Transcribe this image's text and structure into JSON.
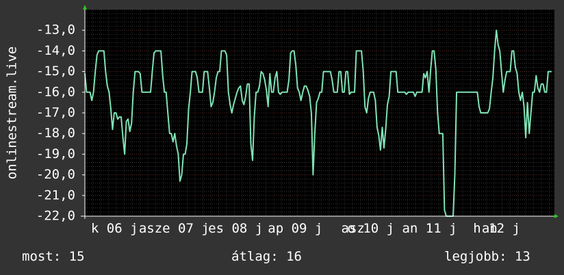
{
  "chart_data": {
    "type": "line",
    "ylabel": "onlinestream.live",
    "ylim": [
      -22.0,
      -12.0
    ],
    "y_ticks": [
      "-13,0",
      "-14,0",
      "-15,0",
      "-16,0",
      "-17,0",
      "-18,0",
      "-19,0",
      "-20,0",
      "-21,0",
      "-22,0"
    ],
    "y_tick_values": [
      -13,
      -14,
      -15,
      -16,
      -17,
      -18,
      -19,
      -20,
      -21,
      -22
    ],
    "x_ticks": [
      "k 06 j",
      "asze 07 j",
      "es 08 j",
      "ap 09 j",
      "asz",
      "o 10 j",
      "an 11 j",
      "an",
      "h 12 j"
    ],
    "x_tick_positions": [
      0.063,
      0.19,
      0.321,
      0.448,
      0.571,
      0.609,
      0.734,
      0.862,
      0.877
    ],
    "x_range": [
      0,
      100
    ],
    "grid": true,
    "series_color": "#7fe3b5",
    "series": [
      {
        "values": [
          -15.1,
          -16.0,
          -16.0,
          -16.0,
          -16.4,
          -16.0,
          -15.0,
          -14.2,
          -14.0,
          -14.0,
          -14.0,
          -14.0,
          -15.0,
          -15.7,
          -16.0,
          -16.8,
          -17.8,
          -17.0,
          -17.0,
          -17.3,
          -17.2,
          -17.2,
          -18.2,
          -19.0,
          -17.4,
          -17.3,
          -17.9,
          -17.5,
          -16.0,
          -15.0,
          -15.0,
          -15.0,
          -15.1,
          -16.0,
          -16.0,
          -16.0,
          -16.0,
          -16.0,
          -16.0,
          -15.0,
          -14.1,
          -14.0,
          -14.0,
          -14.0,
          -14.0,
          -15.2,
          -16.0,
          -16.0,
          -17.0,
          -18.0,
          -18.0,
          -18.4,
          -18.0,
          -18.6,
          -19.0,
          -20.3,
          -20.0,
          -19.0,
          -19.0,
          -18.5,
          -16.8,
          -16.0,
          -15.0,
          -15.0,
          -15.0,
          -15.3,
          -16.0,
          -16.0,
          -16.0,
          -15.0,
          -15.0,
          -15.0,
          -15.8,
          -16.7,
          -16.5,
          -16.0,
          -15.3,
          -15.0,
          -15.0,
          -14.0,
          -14.0,
          -14.0,
          -14.2,
          -16.0,
          -16.6,
          -17.0,
          -16.6,
          -16.3,
          -16.0,
          -15.8,
          -15.7,
          -16.4,
          -16.6,
          -16.2,
          -15.6,
          -15.6,
          -18.5,
          -19.3,
          -17.2,
          -16.0,
          -16.0,
          -15.7,
          -15.0,
          -15.1,
          -15.4,
          -15.9,
          -16.7,
          -15.1,
          -16.0,
          -16.0,
          -15.3,
          -15.0,
          -16.0,
          -16.1,
          -16.0,
          -16.0,
          -16.0,
          -16.0,
          -15.4,
          -14.1,
          -14.0,
          -14.0,
          -14.7,
          -15.8,
          -16.0,
          -16.4,
          -16.0,
          -15.7,
          -15.7,
          -15.9,
          -16.2,
          -17.0,
          -20.0,
          -18.0,
          -16.5,
          -16.3,
          -16.0,
          -16.0,
          -15.0,
          -15.0,
          -15.0,
          -15.0,
          -15.0,
          -15.4,
          -16.0,
          -16.0,
          -16.0,
          -15.0,
          -15.0,
          -16.0,
          -16.0,
          -15.0,
          -15.0,
          -16.1,
          -16.0,
          -16.0,
          -16.0,
          -14.0,
          -14.0,
          -14.0,
          -14.0,
          -15.0,
          -16.7,
          -17.0,
          -16.3,
          -16.0,
          -16.0,
          -16.0,
          -16.4,
          -17.7,
          -18.1,
          -18.8,
          -17.7,
          -18.7,
          -17.8,
          -16.6,
          -16.2,
          -15.0,
          -15.0,
          -15.0,
          -15.0,
          -16.0,
          -16.0,
          -16.0,
          -16.0,
          -16.0,
          -16.1,
          -16.0,
          -16.0,
          -16.0,
          -16.0,
          -16.2,
          -16.0,
          -16.0,
          -16.0,
          -16.0,
          -15.1,
          -15.3,
          -15.0,
          -16.0,
          -14.9,
          -14.0,
          -14.0,
          -14.9,
          -17.0,
          -18.0,
          -18.0,
          -18.0,
          -21.7,
          -22.0,
          -22.0,
          -22.0,
          -22.0,
          -22.0,
          -20.0,
          -16.0,
          -16.0,
          -16.0,
          -16.0,
          -16.0,
          -16.0,
          -16.0,
          -16.0,
          -16.0,
          -16.0,
          -16.0,
          -16.0,
          -16.0,
          -16.7,
          -17.0,
          -17.0,
          -17.0,
          -17.0,
          -17.0,
          -16.8,
          -16.0,
          -15.3,
          -14.0,
          -13.0,
          -13.7,
          -14.0,
          -15.0,
          -16.0,
          -15.4,
          -15.0,
          -15.0,
          -15.0,
          -14.0,
          -14.0,
          -14.8,
          -15.1,
          -16.0,
          -16.4,
          -16.0,
          -16.7,
          -18.2,
          -16.5,
          -18.0,
          -17.0,
          -16.0,
          -16.0,
          -15.2,
          -15.8,
          -16.0,
          -15.6,
          -15.6,
          -16.0,
          -16.0,
          -15.0,
          -15.0,
          -15.0
        ]
      }
    ]
  },
  "footer": {
    "current": "most: 15",
    "average": "átlag: 16",
    "best": "legjobb: 13"
  }
}
